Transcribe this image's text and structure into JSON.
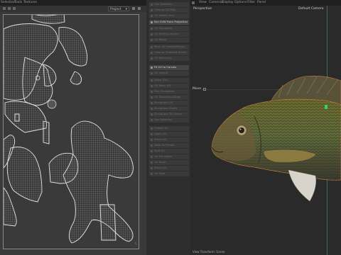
{
  "menu": {
    "items": [
      "Selection",
      "Tools",
      "Textures"
    ]
  },
  "uv_editor": {
    "dropdown": "Project"
  },
  "tools": {
    "group1": [
      "Uvs Selection",
      "Unwrap UV Map",
      "UV Seams Uns",
      "UV Shell Uns"
    ],
    "set_uvw": "Set UVW From Projection",
    "group2": [
      "UV Transform",
      "UV Shell & Unfold",
      "UV Relax",
      "Pack UV Islands/Merge",
      "Unwrap Selected Shells"
    ],
    "fit_uv": "Fit UV to Canvas",
    "group3": [
      "UV Layout",
      "Relax UVs",
      "UV Warp HD",
      "Pick Straighten",
      "UV Straighten/Align",
      "Straighten UV",
      "Straighten Shells",
      "Straighten Tilt Island"
    ],
    "group4": [
      "Flatten UV",
      "Apply UV",
      "Stitch UV",
      "Weld UV Points",
      "Split UV",
      "UV Transform",
      "UV Edge",
      "Stitch UV",
      "UV Tape"
    ]
  },
  "viewport_menu": {
    "items": [
      "View",
      "Cameras",
      "Display",
      "Options",
      "Filter",
      "Panel"
    ]
  },
  "viewport": {
    "perspective": "Perspective",
    "camera": "Default Camera",
    "move_label": "Move",
    "bottom_label": "View Transform: Scene"
  }
}
